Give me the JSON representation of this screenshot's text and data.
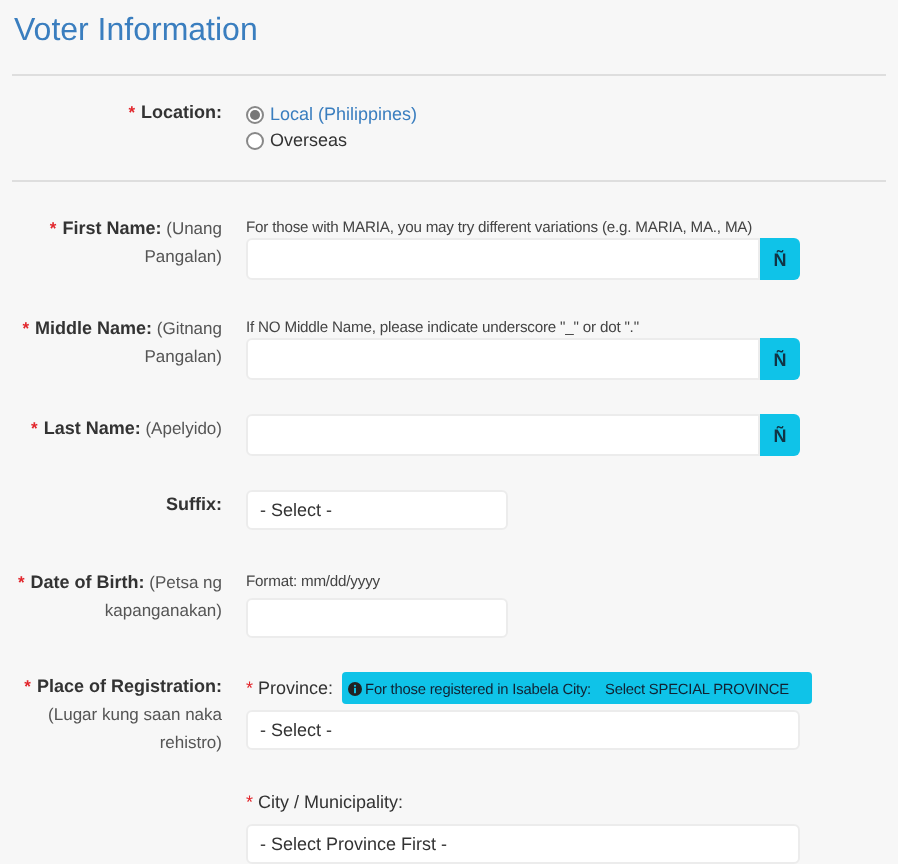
{
  "title": "Voter Information",
  "location": {
    "required_mark": "*",
    "label": "**Location:**",
    "options": [
      {
        "label": "Local (Philippines)",
        "selected": true
      },
      {
        "label": "Overseas",
        "selected": false
      }
    ]
  },
  "fields": [
    {
      "kind": "name",
      "required_mark": "*",
      "label": "**First Name:** (Unang Pangalan)",
      "hint": "For those with MARIA, you may try different variations (e.g. MARIA, MA., MA)",
      "button": "Ñ"
    },
    {
      "kind": "name",
      "required_mark": "*",
      "label": "**Middle Name:** (Gitnang Pangalan)",
      "hint": "If NO Middle Name, please indicate underscore \"_\" or dot \".\"",
      "button": "Ñ"
    },
    {
      "kind": "name",
      "required_mark": "*",
      "label": "**Last Name:** (Apelyido)",
      "button": "Ñ"
    },
    {
      "kind": "select",
      "label": "**Suffix:**",
      "value": "- Select -"
    },
    {
      "kind": "date",
      "required_mark": "*",
      "label": "**Date of Birth:** (Petsa ng kapanganakan)",
      "hint": "Format: mm/dd/yyyy"
    },
    {
      "kind": "place",
      "required_mark": "*",
      "label": "**Place of Registration:** (Lugar kung saan naka rehistro)",
      "parts": [
        {
          "required_mark": "*",
          "label": "Province:",
          "notice": [
            "For those registered in Isabela City:",
            "Select SPECIAL PROVINCE"
          ],
          "value": "- Select -"
        },
        {
          "required_mark": "*",
          "label": "City / Municipality:",
          "value": "- Select Province First -"
        }
      ]
    }
  ]
}
